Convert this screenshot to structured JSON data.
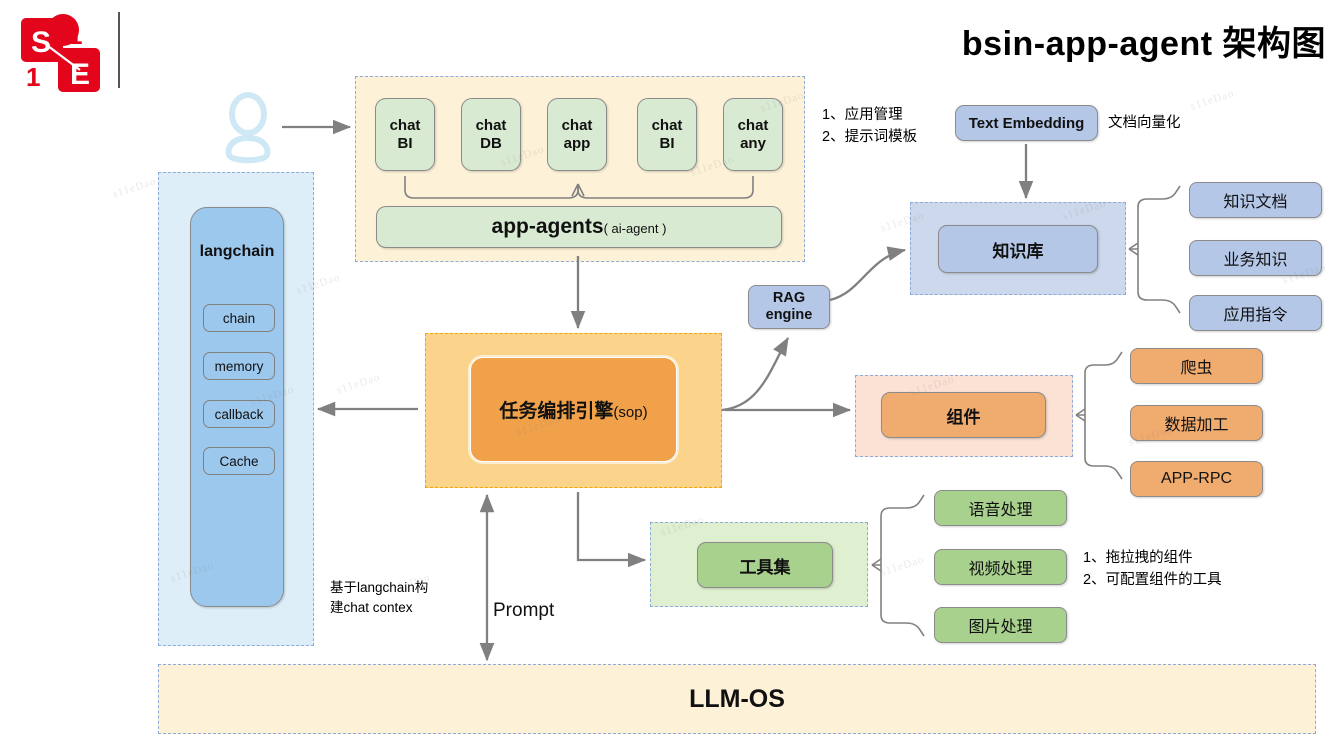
{
  "page": {
    "title": "bsin-app-agent 架构图",
    "logo_alt": "s11e-logo",
    "watermark": "s11eDao"
  },
  "user": {
    "icon": "user-icon"
  },
  "apps_group": {
    "chat_nodes": [
      {
        "line1": "chat",
        "line2": "BI"
      },
      {
        "line1": "chat",
        "line2": "DB"
      },
      {
        "line1": "chat",
        "line2": "app"
      },
      {
        "line1": "chat",
        "line2": "BI"
      },
      {
        "line1": "chat",
        "line2": "any"
      }
    ],
    "app_agents_main": "app-agents",
    "app_agents_sub": "( ai-agent )",
    "annotation": "1、应用管理\n2、提示词模板"
  },
  "langchain": {
    "title": "langchain",
    "items": [
      {
        "label": "chain"
      },
      {
        "label": "memory"
      },
      {
        "label": "callback"
      },
      {
        "label": "Cache"
      }
    ],
    "annotation": "基于langchain构\n建chat contex"
  },
  "engine": {
    "title": "任务编排引擎",
    "sub": "(sop)",
    "prompt_label": "Prompt"
  },
  "rag": {
    "line1": "RAG",
    "line2": "engine"
  },
  "embedding": {
    "label": "Text Embedding",
    "annotation": "文档向量化"
  },
  "knowledge_base": {
    "title": "知识库",
    "leaves": [
      {
        "label": "知识文档"
      },
      {
        "label": "业务知识"
      },
      {
        "label": "应用指令"
      }
    ]
  },
  "components": {
    "title": "组件",
    "leaves": [
      {
        "label": "爬虫"
      },
      {
        "label": "数据加工"
      },
      {
        "label": "APP-RPC"
      }
    ]
  },
  "toolset": {
    "title": "工具集",
    "leaves": [
      {
        "label": "语音处理"
      },
      {
        "label": "视频处理"
      },
      {
        "label": "图片处理"
      }
    ],
    "annotation": "1、拖拉拽的组件\n2、可配置组件的工具"
  },
  "llm_os": {
    "label": "LLM-OS"
  },
  "colors": {
    "green_light": "#d9ead3",
    "green_strong": "#a9d18e",
    "blue_light": "#9dc8ee",
    "blue_pale": "#b4c7e7",
    "orange": "#f0a14a",
    "orange_light": "#f0ab6e",
    "cream": "#fdf2d7",
    "logo_red": "#e3051b",
    "dash_border": "#8ea9db"
  }
}
